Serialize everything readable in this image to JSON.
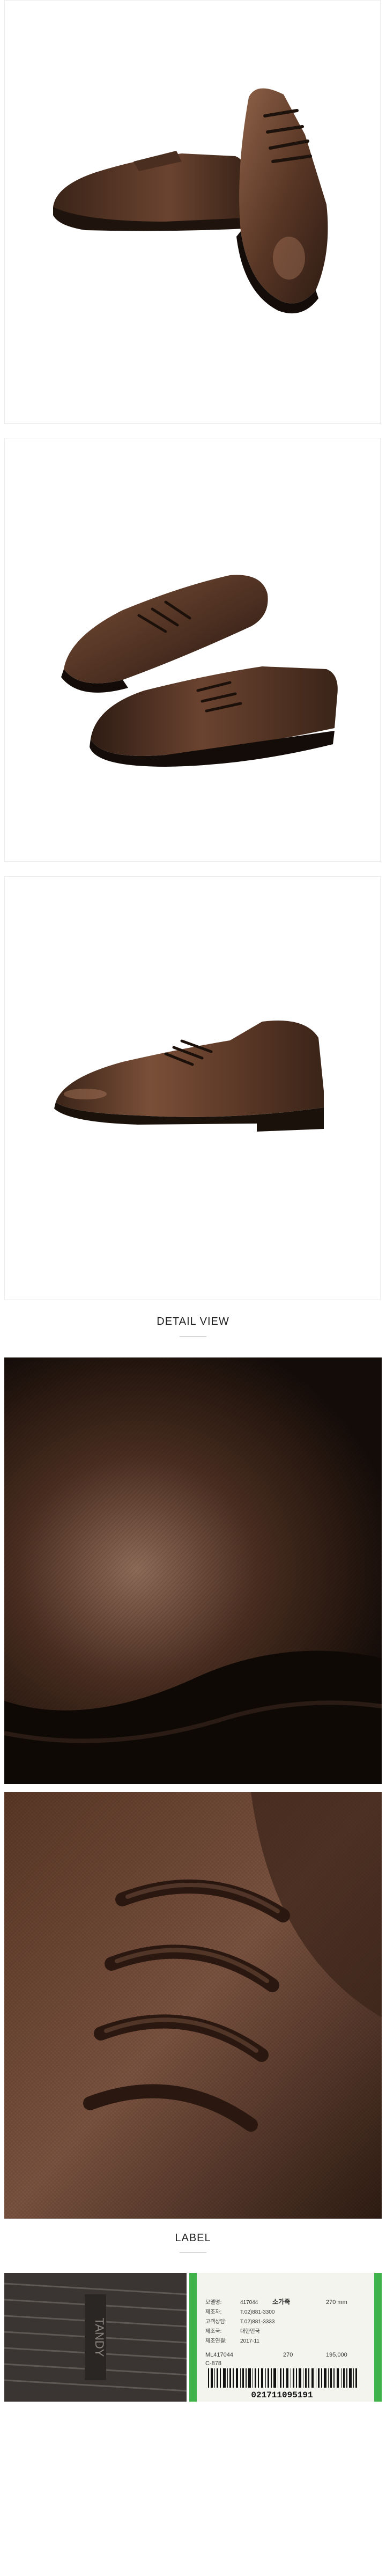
{
  "sections": {
    "detail_view": "DETAIL VIEW",
    "label": "LABEL"
  },
  "product_views": [
    {
      "name": "side-view"
    },
    {
      "name": "pair-view"
    },
    {
      "name": "angle-view"
    }
  ],
  "colors": {
    "leather_dark": "#3a2418",
    "leather_mid": "#6b4330",
    "leather_light": "#8e6248",
    "sole": "#2a1c14",
    "frame_border": "#ececec",
    "tag_green": "#3fb24a"
  },
  "label_tag": {
    "brand_sole": "TANDY",
    "rows": [
      {
        "k": "모델명:",
        "v": "417044"
      },
      {
        "k": "제조자:",
        "v": "T.02)881-3300"
      },
      {
        "k": "고객상담:",
        "v": "T.02)881-3333"
      },
      {
        "k": "제조국:",
        "v": "대한민국"
      },
      {
        "k": "제조연월:",
        "v": "2017-11"
      }
    ],
    "kind": "소가죽",
    "size": "270 mm",
    "code": "ML417044",
    "code2": "C-878",
    "size_num": "270",
    "price": "195,000",
    "barcode": "021711095191"
  }
}
